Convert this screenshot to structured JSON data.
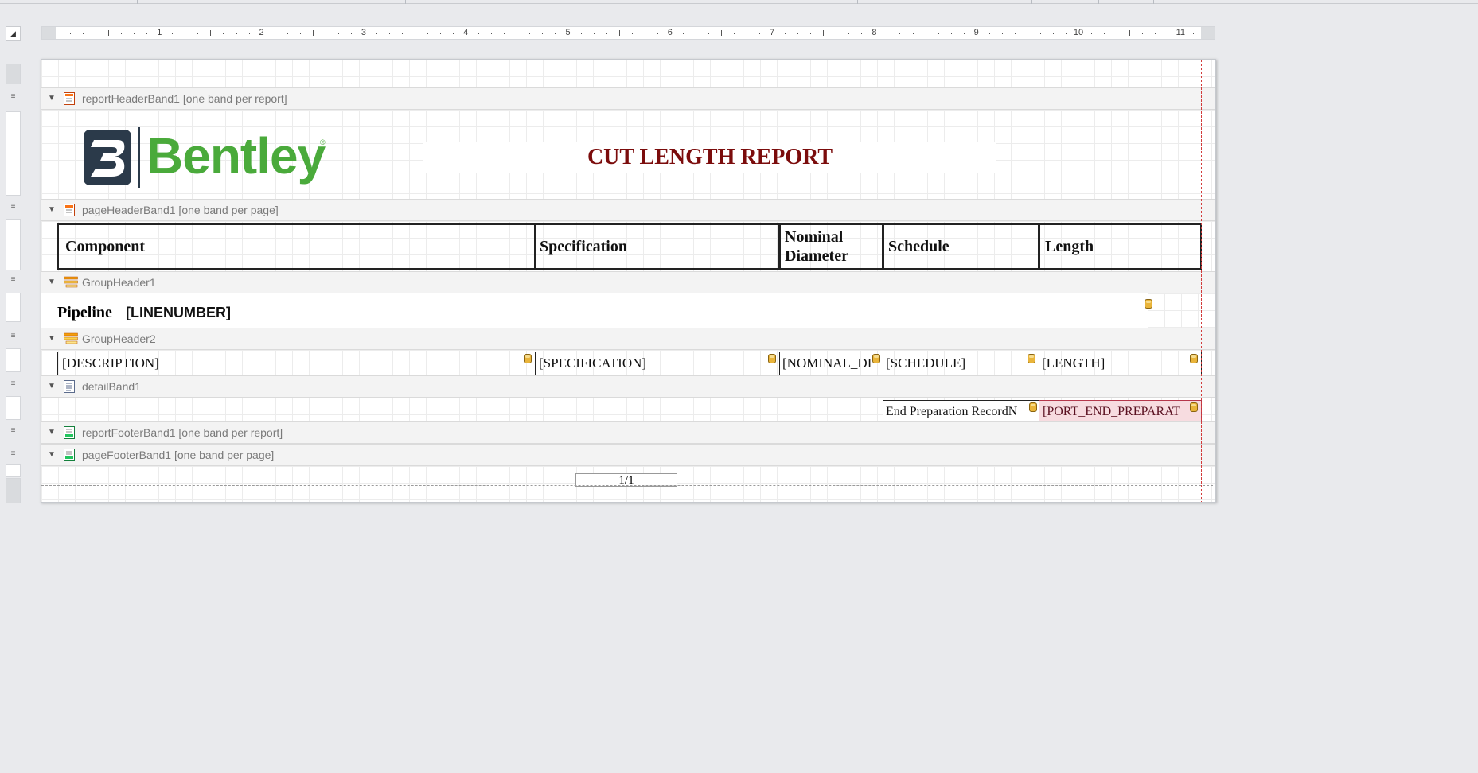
{
  "report": {
    "title": "CUT LENGTH REPORT",
    "logo_text": "Bentley",
    "title_color": "#7b0c0c",
    "logo_color": "#4aaa3b"
  },
  "ruler": {
    "numbers": [
      "1",
      "2",
      "3",
      "4",
      "5",
      "6",
      "7",
      "8",
      "9",
      "10",
      "11"
    ]
  },
  "bands": {
    "report_header": "reportHeaderBand1 [one band per report]",
    "page_header": "pageHeaderBand1 [one band per page]",
    "group_header1": "GroupHeader1",
    "group_header2": "GroupHeader2",
    "detail": "detailBand1",
    "report_footer": "reportFooterBand1 [one band per report]",
    "page_footer": "pageFooterBand1 [one band per page]"
  },
  "columns": {
    "component": "Component",
    "specification": "Specification",
    "nominal_line1": "Nominal",
    "nominal_line2": "Diameter",
    "schedule": "Schedule",
    "length": "Length"
  },
  "group1": {
    "label": "Pipeline",
    "field": "[LINENUMBER]"
  },
  "group2": {
    "description": "[DESCRIPTION]",
    "specification": "[SPECIFICATION]",
    "nominal": "[NOMINAL_DI",
    "schedule": "[SCHEDULE]",
    "length": "[LENGTH]"
  },
  "detail": {
    "label": "End Preparation Record",
    "label_overflow": "N",
    "field": "[PORT_END_PREPARAT"
  },
  "footer": {
    "page_number": "1/1"
  }
}
